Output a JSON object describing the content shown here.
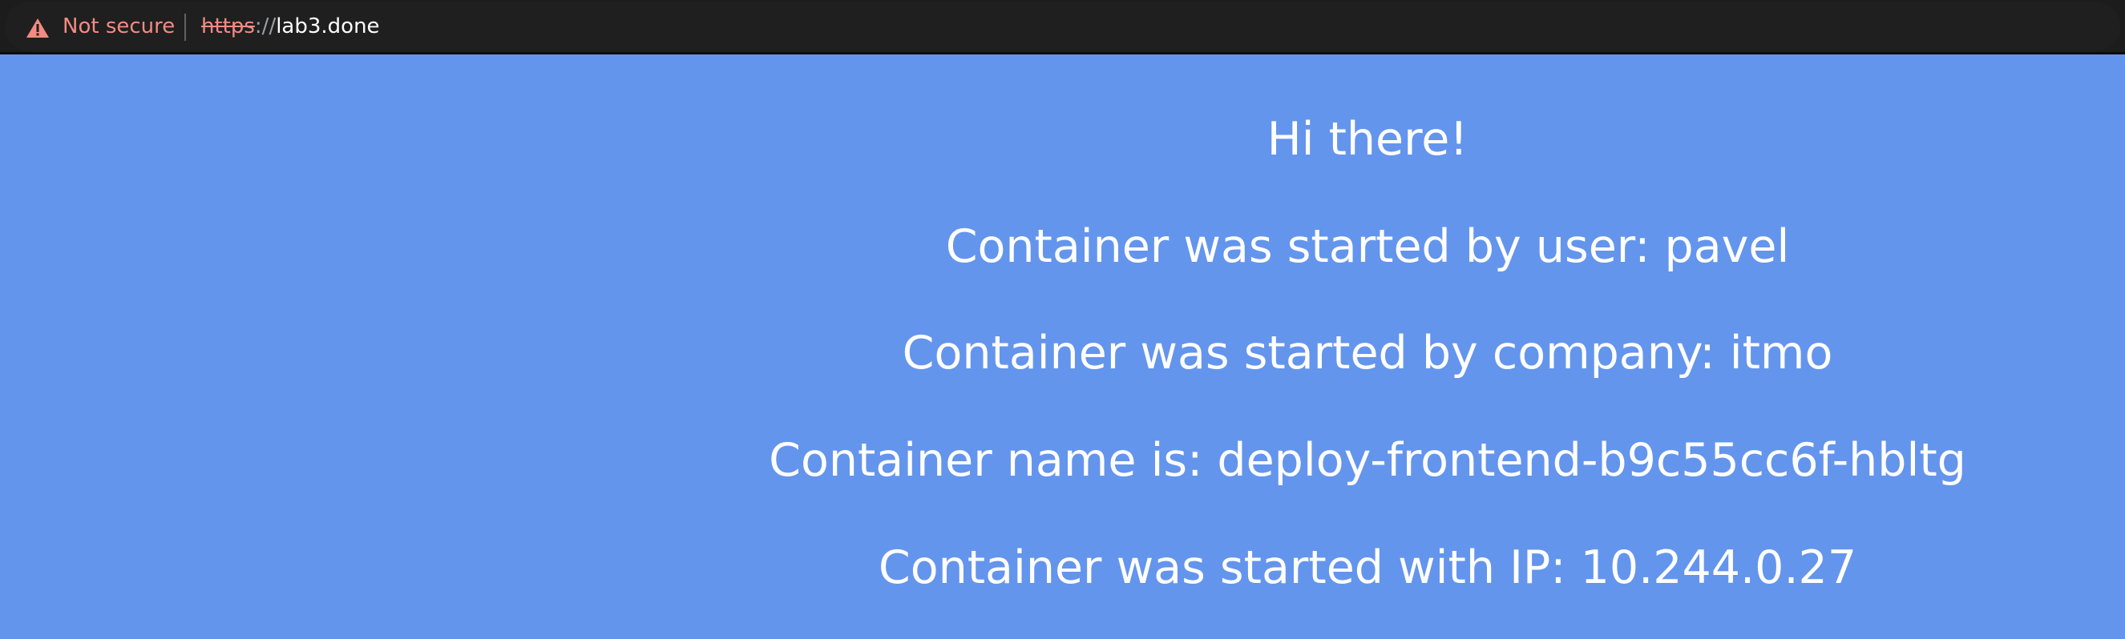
{
  "browser": {
    "security_icon": "warning-triangle-icon",
    "security_label": "Not secure",
    "url": {
      "scheme": "https",
      "separator": "://",
      "host": "lab3.done"
    },
    "colors": {
      "toolbar_background": "#1c1c1c",
      "security_warning": "#f28b82"
    }
  },
  "page": {
    "background_color": "#6495ed",
    "text_color": "#ffffff",
    "lines": [
      "Hi there!",
      "Container was started by user: pavel",
      "Container was started by company: itmo",
      "Container name is: deploy-frontend-b9c55cc6f-hbltg",
      "Container was started with IP: 10.244.0.27"
    ]
  }
}
